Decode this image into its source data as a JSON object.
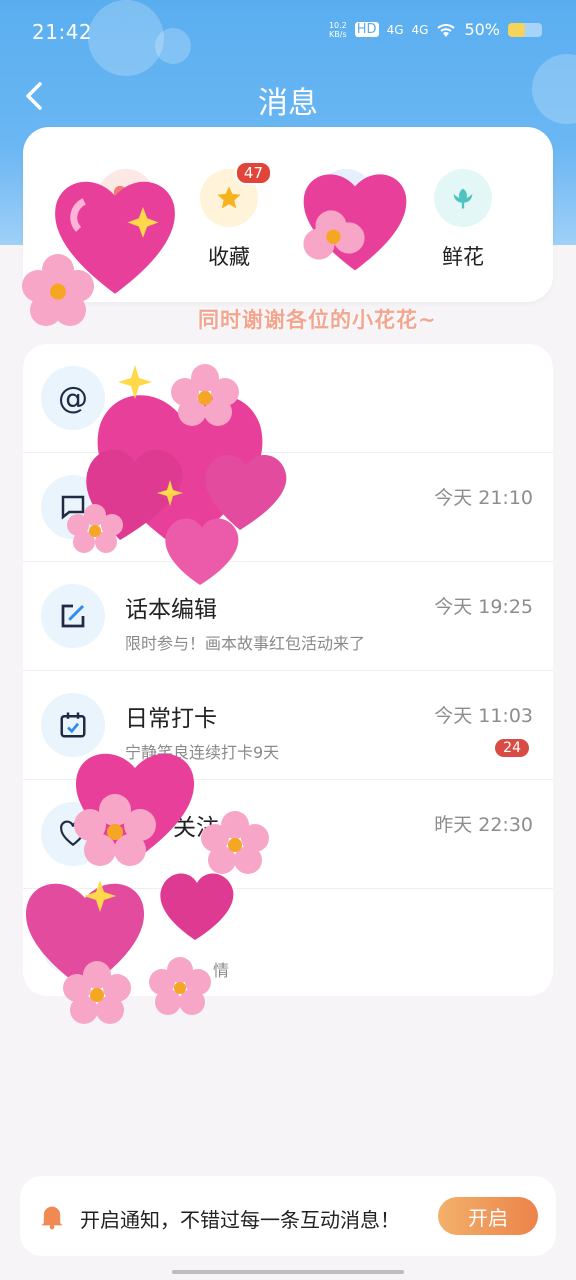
{
  "status": {
    "time": "21:42",
    "net_speed_top": "10.2",
    "net_speed_unit": "KB/s",
    "hd": "HD",
    "sig1": "4G",
    "sig2": "4G",
    "battery_pct": "50%",
    "battery_level": 0.5
  },
  "nav": {
    "title": "消息"
  },
  "quick": {
    "items": [
      {
        "label": "",
        "icon": "heart-icon"
      },
      {
        "label": "收藏",
        "icon": "star-icon",
        "badge": "47"
      },
      {
        "label": "",
        "icon": "user-icon"
      },
      {
        "label": "鲜花",
        "icon": "flower-icon"
      }
    ]
  },
  "banner_text": "同时谢谢各位的小花花~",
  "list": [
    {
      "title": "",
      "subtitle": "",
      "time": "",
      "icon": "at-icon"
    },
    {
      "title": "",
      "subtitle": "",
      "time": "今天 21:10",
      "icon": "comment-icon"
    },
    {
      "title": "话本编辑",
      "subtitle": "限时参与！画本故事红包活动来了",
      "time": "今天 19:25",
      "icon": "edit-icon"
    },
    {
      "title": "日常打卡",
      "subtitle": "宁静笑良连续打卡9天",
      "time": "今天 11:03",
      "icon": "calendar-check-icon",
      "badge": "24"
    },
    {
      "title": "关注",
      "subtitle": "",
      "time": "昨天 22:30",
      "icon": "heart-outline-icon"
    },
    {
      "title": "",
      "subtitle": "情",
      "time": "",
      "icon": "bell-icon"
    }
  ],
  "notify": {
    "text": "开启通知，不错过每一条互动消息！",
    "button": "开启"
  },
  "colors": {
    "header": "#5aaef0",
    "badge": "#e0443a",
    "accent": "#ec8349"
  }
}
